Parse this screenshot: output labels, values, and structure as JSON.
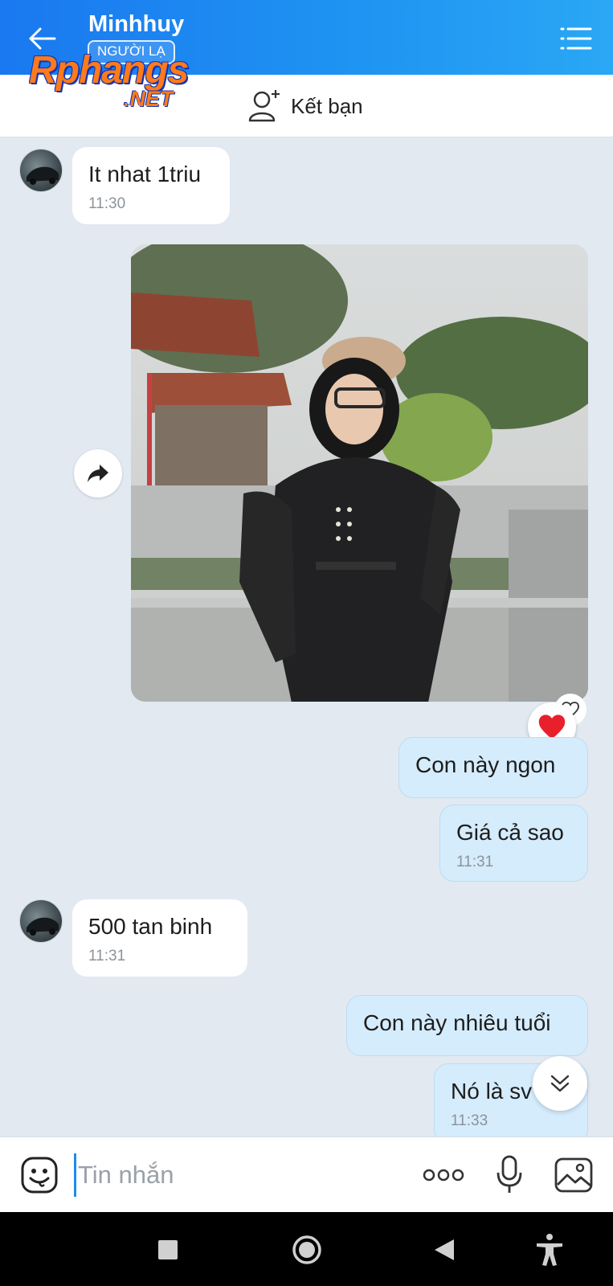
{
  "header": {
    "contact_name": "Minhhuy",
    "stranger_badge": "NGƯỜI LẠ"
  },
  "watermark": {
    "main": "Rphangs",
    "sub": ".NET"
  },
  "friend_bar": {
    "add_friend_label": "Kết bạn"
  },
  "messages": [
    {
      "direction": "in",
      "text": "It nhat 1triu",
      "time": "11:30"
    },
    {
      "direction": "out",
      "type": "image",
      "content": "photo",
      "reaction": "heart"
    },
    {
      "direction": "out",
      "text": "Con này ngon",
      "time": ""
    },
    {
      "direction": "out",
      "text": "Giá cả sao",
      "time": "11:31"
    },
    {
      "direction": "in",
      "text": "500 tan binh",
      "time": "11:31"
    },
    {
      "direction": "out",
      "text": "Con này nhiêu tuổi",
      "time": ""
    },
    {
      "direction": "out",
      "text": "Nó là sv",
      "time": "11:33"
    }
  ],
  "input_bar": {
    "placeholder": "Tin nhắn"
  },
  "colors": {
    "header_start": "#1a78f0",
    "header_end": "#2aa7f5",
    "outgoing_bubble": "#d5ecfc",
    "incoming_bubble": "#ffffff",
    "chat_background": "#e2e9f1",
    "reaction_heart": "#e8202c"
  },
  "icons": {
    "back": "arrow-left-icon",
    "menu": "list-menu-icon",
    "add_friend": "person-add-icon",
    "share": "share-forward-icon",
    "reaction": "heart-icon",
    "scroll_down": "double-chevron-down-icon",
    "emoji": "sticker-face-icon",
    "more": "three-dots-icon",
    "mic": "microphone-icon",
    "gallery": "image-icon"
  }
}
